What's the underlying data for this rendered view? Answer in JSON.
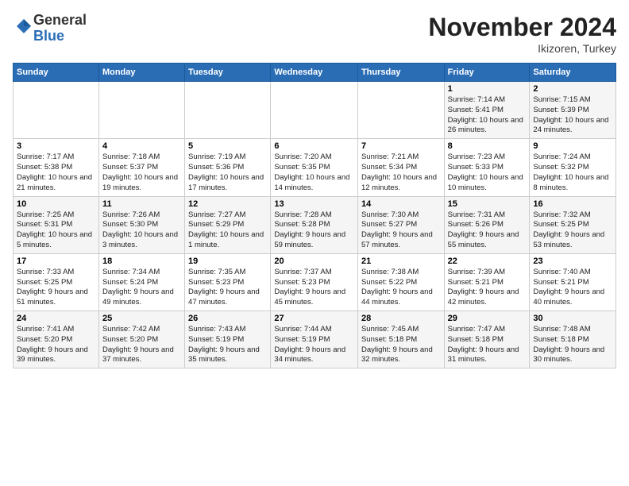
{
  "logo": {
    "general": "General",
    "blue": "Blue"
  },
  "header": {
    "month": "November 2024",
    "location": "Ikizoren, Turkey"
  },
  "days_of_week": [
    "Sunday",
    "Monday",
    "Tuesday",
    "Wednesday",
    "Thursday",
    "Friday",
    "Saturday"
  ],
  "weeks": [
    [
      null,
      null,
      null,
      null,
      null,
      {
        "day": "1",
        "sunrise": "7:14 AM",
        "sunset": "5:41 PM",
        "daylight": "10 hours and 26 minutes."
      },
      {
        "day": "2",
        "sunrise": "7:15 AM",
        "sunset": "5:39 PM",
        "daylight": "10 hours and 24 minutes."
      }
    ],
    [
      {
        "day": "3",
        "sunrise": "7:17 AM",
        "sunset": "5:38 PM",
        "daylight": "10 hours and 21 minutes."
      },
      {
        "day": "4",
        "sunrise": "7:18 AM",
        "sunset": "5:37 PM",
        "daylight": "10 hours and 19 minutes."
      },
      {
        "day": "5",
        "sunrise": "7:19 AM",
        "sunset": "5:36 PM",
        "daylight": "10 hours and 17 minutes."
      },
      {
        "day": "6",
        "sunrise": "7:20 AM",
        "sunset": "5:35 PM",
        "daylight": "10 hours and 14 minutes."
      },
      {
        "day": "7",
        "sunrise": "7:21 AM",
        "sunset": "5:34 PM",
        "daylight": "10 hours and 12 minutes."
      },
      {
        "day": "8",
        "sunrise": "7:23 AM",
        "sunset": "5:33 PM",
        "daylight": "10 hours and 10 minutes."
      },
      {
        "day": "9",
        "sunrise": "7:24 AM",
        "sunset": "5:32 PM",
        "daylight": "10 hours and 8 minutes."
      }
    ],
    [
      {
        "day": "10",
        "sunrise": "7:25 AM",
        "sunset": "5:31 PM",
        "daylight": "10 hours and 5 minutes."
      },
      {
        "day": "11",
        "sunrise": "7:26 AM",
        "sunset": "5:30 PM",
        "daylight": "10 hours and 3 minutes."
      },
      {
        "day": "12",
        "sunrise": "7:27 AM",
        "sunset": "5:29 PM",
        "daylight": "10 hours and 1 minute."
      },
      {
        "day": "13",
        "sunrise": "7:28 AM",
        "sunset": "5:28 PM",
        "daylight": "9 hours and 59 minutes."
      },
      {
        "day": "14",
        "sunrise": "7:30 AM",
        "sunset": "5:27 PM",
        "daylight": "9 hours and 57 minutes."
      },
      {
        "day": "15",
        "sunrise": "7:31 AM",
        "sunset": "5:26 PM",
        "daylight": "9 hours and 55 minutes."
      },
      {
        "day": "16",
        "sunrise": "7:32 AM",
        "sunset": "5:25 PM",
        "daylight": "9 hours and 53 minutes."
      }
    ],
    [
      {
        "day": "17",
        "sunrise": "7:33 AM",
        "sunset": "5:25 PM",
        "daylight": "9 hours and 51 minutes."
      },
      {
        "day": "18",
        "sunrise": "7:34 AM",
        "sunset": "5:24 PM",
        "daylight": "9 hours and 49 minutes."
      },
      {
        "day": "19",
        "sunrise": "7:35 AM",
        "sunset": "5:23 PM",
        "daylight": "9 hours and 47 minutes."
      },
      {
        "day": "20",
        "sunrise": "7:37 AM",
        "sunset": "5:23 PM",
        "daylight": "9 hours and 45 minutes."
      },
      {
        "day": "21",
        "sunrise": "7:38 AM",
        "sunset": "5:22 PM",
        "daylight": "9 hours and 44 minutes."
      },
      {
        "day": "22",
        "sunrise": "7:39 AM",
        "sunset": "5:21 PM",
        "daylight": "9 hours and 42 minutes."
      },
      {
        "day": "23",
        "sunrise": "7:40 AM",
        "sunset": "5:21 PM",
        "daylight": "9 hours and 40 minutes."
      }
    ],
    [
      {
        "day": "24",
        "sunrise": "7:41 AM",
        "sunset": "5:20 PM",
        "daylight": "9 hours and 39 minutes."
      },
      {
        "day": "25",
        "sunrise": "7:42 AM",
        "sunset": "5:20 PM",
        "daylight": "9 hours and 37 minutes."
      },
      {
        "day": "26",
        "sunrise": "7:43 AM",
        "sunset": "5:19 PM",
        "daylight": "9 hours and 35 minutes."
      },
      {
        "day": "27",
        "sunrise": "7:44 AM",
        "sunset": "5:19 PM",
        "daylight": "9 hours and 34 minutes."
      },
      {
        "day": "28",
        "sunrise": "7:45 AM",
        "sunset": "5:18 PM",
        "daylight": "9 hours and 32 minutes."
      },
      {
        "day": "29",
        "sunrise": "7:47 AM",
        "sunset": "5:18 PM",
        "daylight": "9 hours and 31 minutes."
      },
      {
        "day": "30",
        "sunrise": "7:48 AM",
        "sunset": "5:18 PM",
        "daylight": "9 hours and 30 minutes."
      }
    ]
  ]
}
